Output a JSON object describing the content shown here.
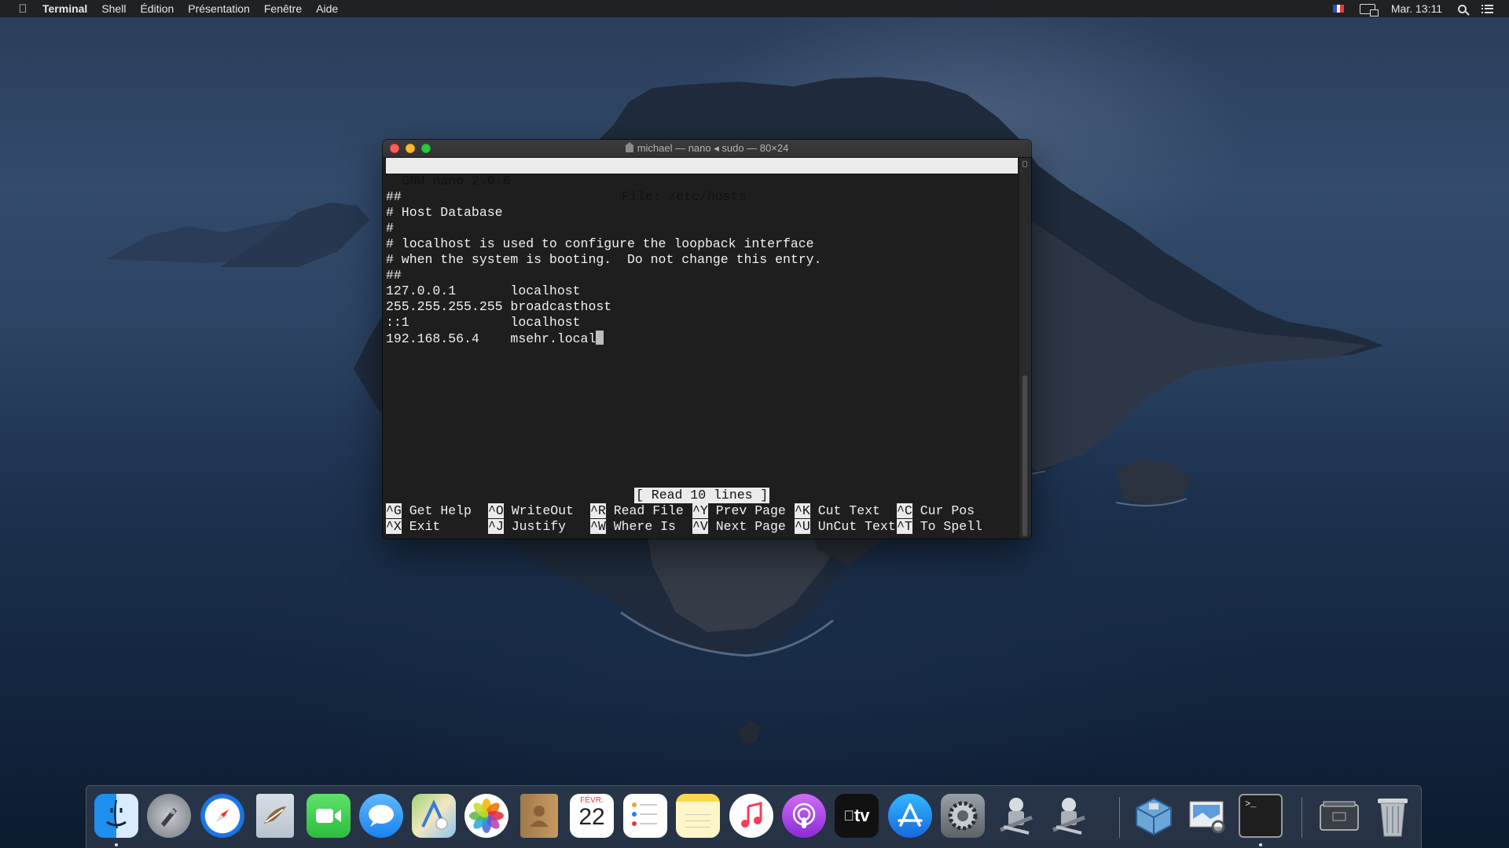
{
  "menubar": {
    "app_name": "Terminal",
    "menus": [
      "Shell",
      "Édition",
      "Présentation",
      "Fenêtre",
      "Aide"
    ],
    "clock": "Mar. 13:11",
    "icons": [
      "apple-logo",
      "french-flag-icon",
      "airplay-mirror-icon",
      "spotlight-search-icon",
      "notification-center-icon"
    ]
  },
  "window": {
    "title": "michael — nano ◂ sudo — 80×24",
    "nano": {
      "version": "GNU nano 2.0.6",
      "file": "File: /etc/hosts",
      "lines": [
        "",
        "##",
        "# Host Database",
        "#",
        "# localhost is used to configure the loopback interface",
        "# when the system is booting.  Do not change this entry.",
        "##",
        "127.0.0.1       localhost",
        "255.255.255.255 broadcasthost",
        "::1             localhost",
        "192.168.56.4    msehr.local"
      ],
      "status": "[ Read 10 lines ]",
      "shortcuts_row1": [
        {
          "key": "^G",
          "label": "Get Help"
        },
        {
          "key": "^O",
          "label": "WriteOut"
        },
        {
          "key": "^R",
          "label": "Read File"
        },
        {
          "key": "^Y",
          "label": "Prev Page"
        },
        {
          "key": "^K",
          "label": "Cut Text"
        },
        {
          "key": "^C",
          "label": "Cur Pos"
        }
      ],
      "shortcuts_row2": [
        {
          "key": "^X",
          "label": "Exit"
        },
        {
          "key": "^J",
          "label": "Justify"
        },
        {
          "key": "^W",
          "label": "Where Is"
        },
        {
          "key": "^V",
          "label": "Next Page"
        },
        {
          "key": "^U",
          "label": "UnCut Text"
        },
        {
          "key": "^T",
          "label": "To Spell"
        }
      ]
    }
  },
  "dock": {
    "items": [
      {
        "name": "finder",
        "running": true
      },
      {
        "name": "launchpad",
        "running": false
      },
      {
        "name": "safari",
        "running": false
      },
      {
        "name": "mail",
        "running": false
      },
      {
        "name": "facetime",
        "running": false
      },
      {
        "name": "messages",
        "running": false
      },
      {
        "name": "maps",
        "running": false
      },
      {
        "name": "photos",
        "running": false
      },
      {
        "name": "contacts",
        "running": false
      },
      {
        "name": "calendar",
        "running": false,
        "month": "FÉVR.",
        "day": "22"
      },
      {
        "name": "reminders",
        "running": false
      },
      {
        "name": "notes",
        "running": false
      },
      {
        "name": "music",
        "running": false
      },
      {
        "name": "podcasts",
        "running": false
      },
      {
        "name": "tv",
        "running": false,
        "label": "tv"
      },
      {
        "name": "app-store",
        "running": false
      },
      {
        "name": "system-preferences",
        "running": false
      },
      {
        "name": "automator",
        "running": false
      },
      {
        "name": "automator-2",
        "running": false
      },
      {
        "name": "virtualbox",
        "running": false
      },
      {
        "name": "preview",
        "running": false
      },
      {
        "name": "terminal",
        "running": true,
        "prompt": ">_"
      },
      {
        "name": "downloads-stack",
        "running": false
      },
      {
        "name": "trash",
        "running": false
      }
    ]
  }
}
